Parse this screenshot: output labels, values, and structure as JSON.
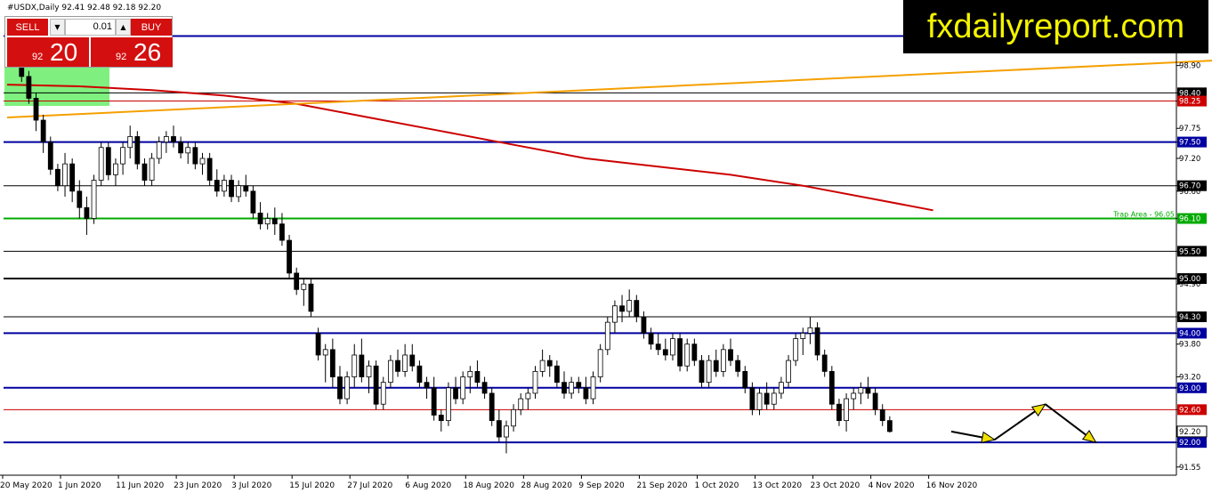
{
  "header": {
    "symbol_line": "#USDX,Daily  92.41 92.48 92.18 92.20"
  },
  "trade_widget": {
    "sell_label": "SELL",
    "buy_label": "BUY",
    "lot_value": "0.01",
    "sell_price_small": "92",
    "sell_price_big": "20",
    "buy_price_small": "92",
    "buy_price_big": "26",
    "color": "#d40f0f"
  },
  "brand": {
    "text": "fxdailyreport.com",
    "text_color": "#f4f400",
    "bg": "#000000"
  },
  "chart_data": {
    "type": "candlestick",
    "symbol": "#USDX",
    "timeframe": "Daily",
    "ylim": [
      91.4,
      100.1
    ],
    "y_tick_labels": [
      "98.90",
      "98.40",
      "98.25",
      "97.75",
      "97.50",
      "97.20",
      "96.70",
      "96.60",
      "96.10",
      "95.50",
      "95.00",
      "94.90",
      "94.30",
      "94.00",
      "93.80",
      "93.20",
      "93.00",
      "92.60",
      "92.20",
      "92.00",
      "91.55"
    ],
    "x_tick_labels": [
      "20 May 2020",
      "1 Jun 2020",
      "11 Jun 2020",
      "23 Jun 2020",
      "3 Jul 2020",
      "15 Jul 2020",
      "27 Jul 2020",
      "6 Aug 2020",
      "18 Aug 2020",
      "28 Aug 2020",
      "9 Sep 2020",
      "21 Sep 2020",
      "1 Oct 2020",
      "13 Oct 2020",
      "23 Oct 2020",
      "4 Nov 2020",
      "16 Nov 2020"
    ],
    "x_tick_indices": [
      0,
      8,
      16,
      24,
      32,
      40,
      48,
      56,
      64,
      72,
      80,
      88,
      96,
      104,
      112,
      120,
      128
    ],
    "candles": [
      [
        99.4,
        99.6,
        99.1,
        99.2
      ],
      [
        99.2,
        99.3,
        98.9,
        99.0
      ],
      [
        99.0,
        99.1,
        98.6,
        98.7
      ],
      [
        98.7,
        98.8,
        98.2,
        98.3
      ],
      [
        98.3,
        98.4,
        97.7,
        97.9
      ],
      [
        97.9,
        98.0,
        97.3,
        97.5
      ],
      [
        97.5,
        97.6,
        96.9,
        97.0
      ],
      [
        97.0,
        97.1,
        96.6,
        96.7
      ],
      [
        96.7,
        97.3,
        96.5,
        97.1
      ],
      [
        97.1,
        97.2,
        96.4,
        96.6
      ],
      [
        96.6,
        96.8,
        96.1,
        96.3
      ],
      [
        96.3,
        96.5,
        95.8,
        96.1
      ],
      [
        96.1,
        96.9,
        96.0,
        96.8
      ],
      [
        96.8,
        97.5,
        96.7,
        97.4
      ],
      [
        97.4,
        97.5,
        96.8,
        96.9
      ],
      [
        96.9,
        97.2,
        96.7,
        97.1
      ],
      [
        97.1,
        97.5,
        96.9,
        97.4
      ],
      [
        97.4,
        97.8,
        97.2,
        97.6
      ],
      [
        97.6,
        97.7,
        97.0,
        97.1
      ],
      [
        97.1,
        97.2,
        96.7,
        96.8
      ],
      [
        96.8,
        97.3,
        96.7,
        97.2
      ],
      [
        97.2,
        97.6,
        97.1,
        97.5
      ],
      [
        97.5,
        97.7,
        97.3,
        97.6
      ],
      [
        97.6,
        97.8,
        97.4,
        97.5
      ],
      [
        97.5,
        97.6,
        97.2,
        97.3
      ],
      [
        97.3,
        97.5,
        97.1,
        97.4
      ],
      [
        97.4,
        97.5,
        97.0,
        97.1
      ],
      [
        97.1,
        97.3,
        96.9,
        97.2
      ],
      [
        97.2,
        97.3,
        96.7,
        96.8
      ],
      [
        96.8,
        97.0,
        96.5,
        96.6
      ],
      [
        96.6,
        96.9,
        96.5,
        96.8
      ],
      [
        96.8,
        96.9,
        96.4,
        96.5
      ],
      [
        96.5,
        96.8,
        96.4,
        96.7
      ],
      [
        96.7,
        96.9,
        96.5,
        96.6
      ],
      [
        96.6,
        96.7,
        96.1,
        96.2
      ],
      [
        96.2,
        96.4,
        95.9,
        96.0
      ],
      [
        96.0,
        96.2,
        95.9,
        96.1
      ],
      [
        96.1,
        96.3,
        95.8,
        96.0
      ],
      [
        96.0,
        96.2,
        95.6,
        95.7
      ],
      [
        95.7,
        95.8,
        95.0,
        95.1
      ],
      [
        95.1,
        95.2,
        94.7,
        94.8
      ],
      [
        94.8,
        95.0,
        94.5,
        94.9
      ],
      [
        94.9,
        95.0,
        94.3,
        94.4
      ],
      [
        94.0,
        94.1,
        93.5,
        93.6
      ],
      [
        93.6,
        93.8,
        93.1,
        93.7
      ],
      [
        93.7,
        93.9,
        93.0,
        93.2
      ],
      [
        93.2,
        93.4,
        92.7,
        92.8
      ],
      [
        92.8,
        93.3,
        92.7,
        93.2
      ],
      [
        93.2,
        93.8,
        93.0,
        93.6
      ],
      [
        93.6,
        93.9,
        93.1,
        93.2
      ],
      [
        93.2,
        93.5,
        92.9,
        93.4
      ],
      [
        93.4,
        93.5,
        92.6,
        92.7
      ],
      [
        92.7,
        93.2,
        92.6,
        93.1
      ],
      [
        93.1,
        93.6,
        93.0,
        93.5
      ],
      [
        93.5,
        93.7,
        93.2,
        93.3
      ],
      [
        93.3,
        93.8,
        93.2,
        93.6
      ],
      [
        93.6,
        93.8,
        93.3,
        93.4
      ],
      [
        93.4,
        93.5,
        93.0,
        93.1
      ],
      [
        93.1,
        93.2,
        92.8,
        93.0
      ],
      [
        93.0,
        93.2,
        92.4,
        92.5
      ],
      [
        92.5,
        92.6,
        92.2,
        92.4
      ],
      [
        92.4,
        93.1,
        92.3,
        93.0
      ],
      [
        93.0,
        93.2,
        92.7,
        92.8
      ],
      [
        92.8,
        93.3,
        92.7,
        93.2
      ],
      [
        93.2,
        93.4,
        92.9,
        93.3
      ],
      [
        93.3,
        93.5,
        93.0,
        93.1
      ],
      [
        93.1,
        93.2,
        92.8,
        92.9
      ],
      [
        92.9,
        93.0,
        92.3,
        92.4
      ],
      [
        92.4,
        92.6,
        92.0,
        92.1
      ],
      [
        92.1,
        92.4,
        91.8,
        92.3
      ],
      [
        92.3,
        92.7,
        92.2,
        92.6
      ],
      [
        92.6,
        92.9,
        92.5,
        92.8
      ],
      [
        92.8,
        93.0,
        92.6,
        92.9
      ],
      [
        92.9,
        93.4,
        92.8,
        93.3
      ],
      [
        93.3,
        93.7,
        93.2,
        93.5
      ],
      [
        93.5,
        93.6,
        93.2,
        93.4
      ],
      [
        93.4,
        93.5,
        93.0,
        93.1
      ],
      [
        93.1,
        93.3,
        92.8,
        92.9
      ],
      [
        92.9,
        93.2,
        92.8,
        93.1
      ],
      [
        93.1,
        93.2,
        92.9,
        93.0
      ],
      [
        93.0,
        93.2,
        92.7,
        92.8
      ],
      [
        92.8,
        93.3,
        92.7,
        93.2
      ],
      [
        93.2,
        93.8,
        93.1,
        93.7
      ],
      [
        93.7,
        94.3,
        93.6,
        94.2
      ],
      [
        94.2,
        94.6,
        94.0,
        94.5
      ],
      [
        94.5,
        94.7,
        94.2,
        94.4
      ],
      [
        94.4,
        94.8,
        94.3,
        94.6
      ],
      [
        94.6,
        94.7,
        94.2,
        94.3
      ],
      [
        94.3,
        94.4,
        93.9,
        94.0
      ],
      [
        94.0,
        94.1,
        93.7,
        93.8
      ],
      [
        93.8,
        94.0,
        93.6,
        93.7
      ],
      [
        93.7,
        93.9,
        93.5,
        93.6
      ],
      [
        93.6,
        94.0,
        93.5,
        93.9
      ],
      [
        93.9,
        94.0,
        93.3,
        93.4
      ],
      [
        93.4,
        93.9,
        93.3,
        93.8
      ],
      [
        93.8,
        93.9,
        93.4,
        93.5
      ],
      [
        93.5,
        93.6,
        93.0,
        93.1
      ],
      [
        93.1,
        93.6,
        93.0,
        93.5
      ],
      [
        93.5,
        93.7,
        93.2,
        93.3
      ],
      [
        93.3,
        93.8,
        93.2,
        93.7
      ],
      [
        93.7,
        93.9,
        93.4,
        93.5
      ],
      [
        93.5,
        93.6,
        93.2,
        93.3
      ],
      [
        93.3,
        93.4,
        92.9,
        93.0
      ],
      [
        93.0,
        93.1,
        92.5,
        92.6
      ],
      [
        92.6,
        93.0,
        92.5,
        92.9
      ],
      [
        92.9,
        93.1,
        92.6,
        92.7
      ],
      [
        92.7,
        93.0,
        92.6,
        92.9
      ],
      [
        92.9,
        93.2,
        92.8,
        93.1
      ],
      [
        93.1,
        93.6,
        93.0,
        93.5
      ],
      [
        93.5,
        94.0,
        93.4,
        93.9
      ],
      [
        93.9,
        94.1,
        93.6,
        94.0
      ],
      [
        94.0,
        94.3,
        93.8,
        94.1
      ],
      [
        94.1,
        94.2,
        93.5,
        93.6
      ],
      [
        93.6,
        93.7,
        93.2,
        93.3
      ],
      [
        93.3,
        93.4,
        92.6,
        92.7
      ],
      [
        92.7,
        92.8,
        92.3,
        92.4
      ],
      [
        92.4,
        92.9,
        92.2,
        92.8
      ],
      [
        92.8,
        93.0,
        92.6,
        92.9
      ],
      [
        92.9,
        93.1,
        92.7,
        93.0
      ],
      [
        93.0,
        93.2,
        92.8,
        92.9
      ],
      [
        92.9,
        93.0,
        92.5,
        92.6
      ],
      [
        92.6,
        92.7,
        92.3,
        92.4
      ],
      [
        92.4,
        92.48,
        92.18,
        92.2
      ]
    ],
    "series": [
      {
        "name": "",
        "kind": "moving-average",
        "color": "#cc0000",
        "x": [
          0,
          10,
          20,
          30,
          40,
          50,
          60,
          70,
          80,
          90,
          100,
          110,
          120,
          128
        ],
        "values": [
          98.55,
          98.52,
          98.45,
          98.35,
          98.2,
          97.95,
          97.7,
          97.45,
          97.2,
          97.05,
          96.9,
          96.7,
          96.45,
          96.25
        ]
      },
      {
        "name": "",
        "kind": "trendline",
        "color": "#f5a000",
        "x": [
          0,
          208
        ],
        "values": [
          97.95,
          99.25
        ]
      }
    ],
    "horizontal_levels": [
      {
        "value": 99.44,
        "label": "99.40",
        "color": "#0000a0",
        "width": 2
      },
      {
        "value": 98.4,
        "label": "98.40",
        "color": "#000000",
        "width": 1
      },
      {
        "value": 98.25,
        "label": "98.25",
        "color": "#cc0000",
        "width": 1
      },
      {
        "value": 97.5,
        "label": "97.50",
        "color": "#0000a0",
        "width": 2
      },
      {
        "value": 96.7,
        "label": "96.70",
        "color": "#000000",
        "width": 1
      },
      {
        "value": 96.1,
        "label": "96.10",
        "color": "#00aa00",
        "width": 2,
        "note": "Trap Area - 96.05"
      },
      {
        "value": 95.5,
        "label": "95.50",
        "color": "#000000",
        "width": 1
      },
      {
        "value": 95.0,
        "label": "95.00",
        "color": "#000000",
        "width": 2
      },
      {
        "value": 94.3,
        "label": "94.30",
        "color": "#000000",
        "width": 1
      },
      {
        "value": 94.0,
        "label": "94.00",
        "color": "#0000a0",
        "width": 2
      },
      {
        "value": 93.0,
        "label": "93.00",
        "color": "#0000a0",
        "width": 2
      },
      {
        "value": 92.6,
        "label": "92.60",
        "color": "#cc0000",
        "width": 1
      },
      {
        "value": 92.0,
        "label": "92.00",
        "color": "#0000a0",
        "width": 2
      }
    ],
    "current_price": {
      "value": 92.2,
      "label": "92.20"
    },
    "projection_arrows": [
      [
        130.5,
        92.2,
        136.5,
        92.05
      ],
      [
        136.5,
        92.05,
        143.5,
        92.7
      ],
      [
        143.5,
        92.7,
        150.5,
        92.0
      ]
    ],
    "grid": false,
    "colors": {
      "bull": "#ffffff",
      "bear": "#000000",
      "wick": "#000000",
      "highlight": "#7ff07f"
    }
  }
}
